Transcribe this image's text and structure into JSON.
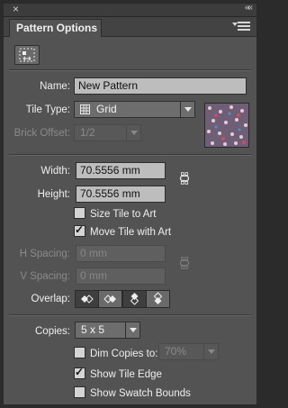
{
  "window": {
    "close_glyph": "×",
    "collapse_glyph": "««"
  },
  "tab": {
    "title": "Pattern Options"
  },
  "icons": {
    "menu": "panel-menu-icon",
    "tile_tool": "pattern-tile-tool-icon",
    "grid": "grid-icon",
    "link": "chain-link-icon",
    "overlap": [
      "left-in-front-icon",
      "right-in-front-icon",
      "top-in-front-icon",
      "bottom-in-front-icon"
    ]
  },
  "form": {
    "name": {
      "label": "Name:",
      "value": "New Pattern"
    },
    "tile_type": {
      "label": "Tile Type:",
      "value": "Grid"
    },
    "brick_offset": {
      "label": "Brick Offset:",
      "value": "1/2"
    },
    "width": {
      "label": "Width:",
      "value": "70.5556 mm"
    },
    "height": {
      "label": "Height:",
      "value": "70.5556 mm"
    },
    "size_tile_to_art": {
      "label": "Size Tile to Art",
      "checked": false
    },
    "move_tile_with_art": {
      "label": "Move Tile with Art",
      "checked": true
    },
    "h_spacing": {
      "label": "H Spacing:",
      "placeholder": "0 mm"
    },
    "v_spacing": {
      "label": "V Spacing:",
      "placeholder": "0 mm"
    },
    "overlap": {
      "label": "Overlap:"
    },
    "copies": {
      "label": "Copies:",
      "value": "5 x 5"
    },
    "dim_copies": {
      "label": "Dim Copies to:",
      "checked": false,
      "value": "70%"
    },
    "show_tile_edge": {
      "label": "Show Tile Edge",
      "checked": true
    },
    "show_swatch_bounds": {
      "label": "Show Swatch Bounds",
      "checked": false
    }
  },
  "colors": {
    "panel_bg": "#535353",
    "field_bg": "#bdbdbd",
    "swatch_bg": "#6b5a72"
  }
}
